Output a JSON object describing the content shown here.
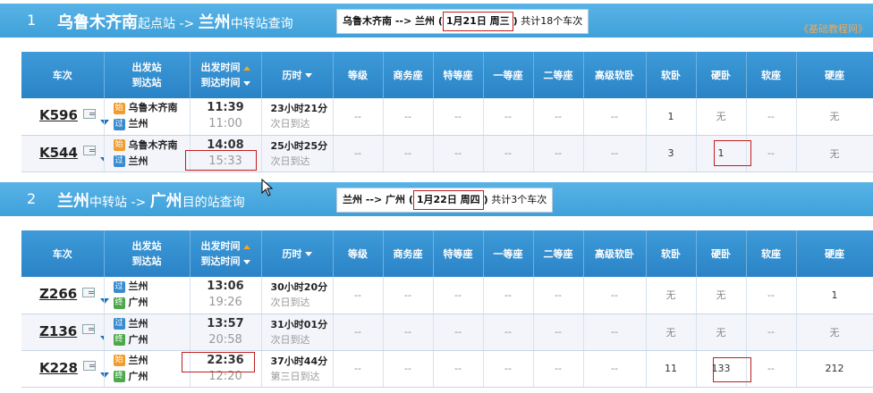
{
  "section1": {
    "num": "1",
    "from": "乌鲁木齐南",
    "from_suffix": "起点站 ->",
    "to": "兰州",
    "to_suffix": "中转站查询",
    "info_route": "乌鲁木齐南 --> 兰州 (",
    "info_date": "1月21日  周三",
    "info_close": ")",
    "info_count": "共计18个车次",
    "watermark": "《基础教程网》"
  },
  "section2": {
    "num": "2",
    "from": "兰州",
    "from_suffix": "中转站 ->",
    "to": "广州",
    "to_suffix": "目的站查询",
    "info_route": "兰州 --> 广州 (",
    "info_date": "1月22日  周四",
    "info_close": ")",
    "info_count": "共计3个车次"
  },
  "headers": {
    "train": "车次",
    "station_dep": "出发站",
    "station_arr": "到达站",
    "time_dep": "出发时间",
    "time_arr": "到达时间",
    "duration": "历时",
    "grade": "等级",
    "business": "商务座",
    "special": "特等座",
    "first": "一等座",
    "second": "二等座",
    "soft_sleeper_hi": "高级软卧",
    "soft_sleeper": "软卧",
    "hard_sleeper": "硬卧",
    "soft_seat": "软座",
    "hard_seat": "硬座"
  },
  "badges": {
    "start": "始",
    "pass": "过",
    "end": "终"
  },
  "table1": [
    {
      "code": "K596",
      "dep_badge": "始",
      "dep_station": "乌鲁木齐南",
      "arr_badge": "过",
      "arr_station": "兰州",
      "dep_time": "11:39",
      "arr_time": "11:00",
      "duration": "23小时21分",
      "note": "次日到达",
      "cells": [
        "--",
        "--",
        "--",
        "--",
        "--",
        "--",
        "1",
        "无",
        "--",
        "无"
      ]
    },
    {
      "code": "K544",
      "dep_badge": "始",
      "dep_station": "乌鲁木齐南",
      "arr_badge": "过",
      "arr_station": "兰州",
      "dep_time": "14:08",
      "arr_time": "15:33",
      "duration": "25小时25分",
      "note": "次日到达",
      "cells": [
        "--",
        "--",
        "--",
        "--",
        "--",
        "--",
        "3",
        "1",
        "--",
        "无"
      ]
    }
  ],
  "table2": [
    {
      "code": "Z266",
      "dep_badge": "过",
      "dep_station": "兰州",
      "arr_badge": "终",
      "arr_station": "广州",
      "dep_time": "13:06",
      "arr_time": "19:26",
      "duration": "30小时20分",
      "note": "次日到达",
      "cells": [
        "--",
        "--",
        "--",
        "--",
        "--",
        "--",
        "无",
        "无",
        "--",
        "1"
      ]
    },
    {
      "code": "Z136",
      "dep_badge": "过",
      "dep_station": "兰州",
      "arr_badge": "终",
      "arr_station": "广州",
      "dep_time": "13:57",
      "arr_time": "20:58",
      "duration": "31小时01分",
      "note": "次日到达",
      "cells": [
        "--",
        "--",
        "--",
        "--",
        "--",
        "--",
        "无",
        "无",
        "--",
        "无"
      ]
    },
    {
      "code": "K228",
      "dep_badge": "始",
      "dep_station": "兰州",
      "arr_badge": "终",
      "arr_station": "广州",
      "dep_time": "22:36",
      "arr_time": "12:20",
      "duration": "37小时44分",
      "note": "第三日到达",
      "cells": [
        "--",
        "--",
        "--",
        "--",
        "--",
        "--",
        "11",
        "133",
        "--",
        "212"
      ]
    }
  ],
  "colors": {
    "header_blue": "#3e9ad8",
    "bar_blue": "#4aaae0",
    "highlight_red": "#c21d1d",
    "badge_start": "#f29b2e",
    "badge_pass": "#3a8bd0",
    "badge_end": "#4da84a"
  }
}
